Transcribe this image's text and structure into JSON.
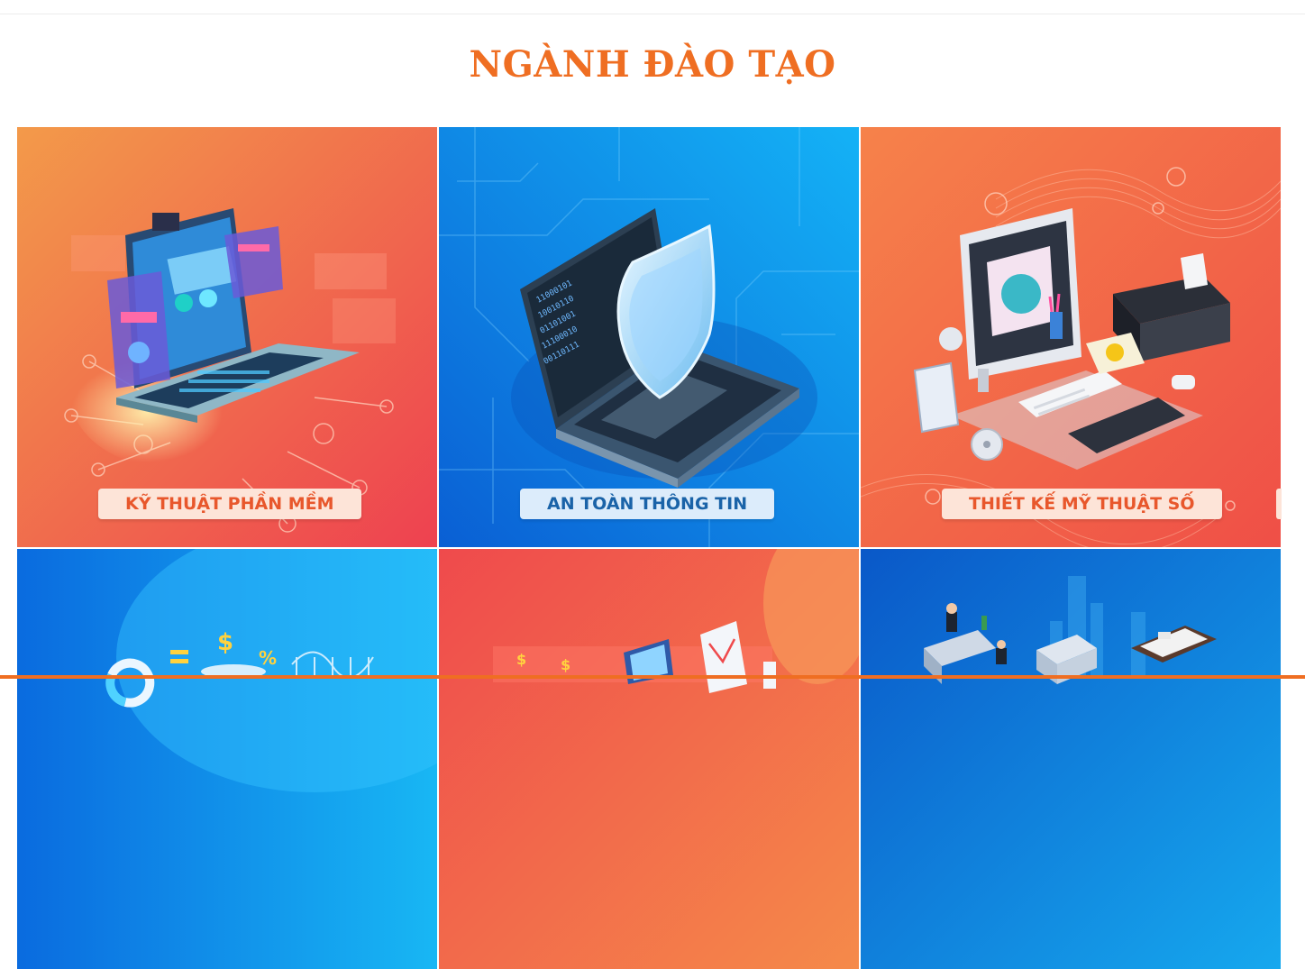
{
  "section": {
    "title": "NGÀNH ĐÀO TẠO"
  },
  "programs": [
    {
      "label": "KỸ THUẬT PHẦN MỀM",
      "theme": "warm",
      "icon": "laptop-dashboard-icon"
    },
    {
      "label": "AN TOÀN THÔNG TIN",
      "theme": "cool",
      "icon": "shield-laptop-icon"
    },
    {
      "label": "THIẾT KẾ MỸ THUẬT SỐ",
      "theme": "warm",
      "icon": "design-workstation-icon"
    },
    {
      "label": "",
      "theme": "cool",
      "icon": "finance-chart-icon"
    },
    {
      "label": "",
      "theme": "warm",
      "icon": "marketing-laptop-icon"
    },
    {
      "label": "",
      "theme": "cool",
      "icon": "hotel-building-icon"
    }
  ],
  "colors": {
    "accent": "#ef6e22",
    "warm_start": "#f28a45",
    "warm_end": "#ef4d4f",
    "cool_start": "#0a64d6",
    "cool_end": "#19b4f5"
  }
}
